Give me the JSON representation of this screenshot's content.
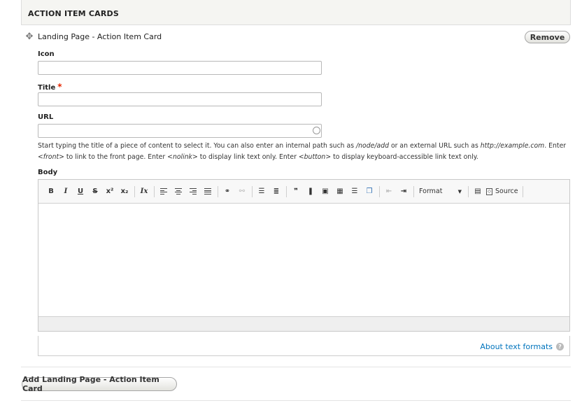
{
  "section": {
    "title": "ACTION ITEM CARDS"
  },
  "item": {
    "title": "Landing Page - Action Item Card",
    "remove_label": "Remove"
  },
  "fields": {
    "icon": {
      "label": "Icon",
      "value": ""
    },
    "title": {
      "label": "Title",
      "required_marker": "*",
      "value": ""
    },
    "url": {
      "label": "URL",
      "value": ""
    }
  },
  "url_help": {
    "t1": "Start typing the title of a piece of content to select it. You can also enter an internal path such as ",
    "e1": "/node/add",
    "t2": " or an external URL such as ",
    "e2": "http://example.com",
    "t3": ". Enter ",
    "e3": "<front>",
    "t4": " to link to the front page. Enter ",
    "e4": "<nolink>",
    "t5": " to display link text only. Enter ",
    "e5": "<button>",
    "t6": " to display keyboard-accessible link text only."
  },
  "body": {
    "label": "Body"
  },
  "toolbar": {
    "bold": "B",
    "italic": "I",
    "underline": "U",
    "strike": "S",
    "superscript": "x²",
    "subscript": "x₂",
    "remove_format": "Ix",
    "blockquote": "❞",
    "format_label": "Format",
    "source_label": "Source"
  },
  "text_formats": {
    "link": "About text formats",
    "help": "?"
  },
  "add_button": "Add Landing Page - Action Item Card"
}
